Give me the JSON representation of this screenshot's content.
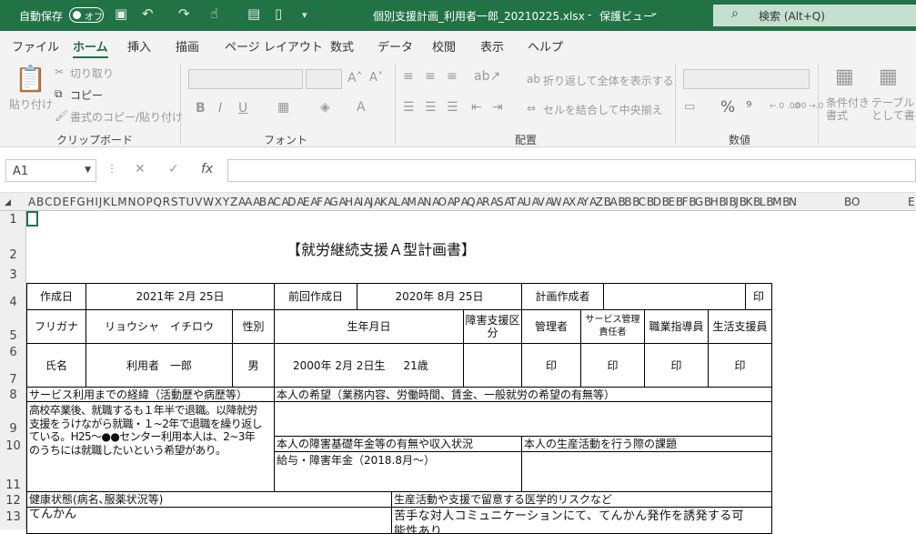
{
  "titlebar": {
    "autosave": "自動保存",
    "autosave_state": "オフ",
    "filename": "個別支援計画_利用者一郎_20210225.xlsx",
    "separator": "-",
    "view_mode": "保護ビュー",
    "mode_arrow": "⌄",
    "search_label": "検索 (Alt+Q)"
  },
  "tabs": [
    "ファイル",
    "ホーム",
    "挿入",
    "描画",
    "ページ レイアウト",
    "数式",
    "データ",
    "校閲",
    "表示",
    "ヘルプ"
  ],
  "ribbon": {
    "paste": "貼り付け",
    "cut": "切り取り",
    "copy": "コピー",
    "format_painter": "書式のコピー/貼り付け",
    "clipboard": "クリップボード",
    "font_group": "フォント",
    "bold": "B",
    "italic": "I",
    "underline": "U",
    "grow": "A˄",
    "shrink": "A˅",
    "wrap": "折り返して全体を表示する",
    "merge": "セルを結合して中央揃え",
    "align_group": "配置",
    "number_group": "数値",
    "percent": "%",
    "comma": "⁹",
    "dec_inc": "←.0 .00",
    "dec_dec": ".00 →.0",
    "cond_format": "条件付き書式",
    "table_format": "テーブルとして書式設定"
  },
  "formula": {
    "namebox": "A1",
    "cancel": "✕",
    "enter": "✓",
    "fx": "fx"
  },
  "columns": [
    "A",
    "B",
    "C",
    "D",
    "E",
    "F",
    "G",
    "H",
    "I",
    "J",
    "K",
    "L",
    "M",
    "N",
    "O",
    "P",
    "Q",
    "R",
    "S",
    "T",
    "U",
    "V",
    "W",
    "X",
    "Y",
    "Z",
    "A A",
    "AB",
    "AC",
    "AD",
    "AE",
    "AF",
    "AG",
    "AH",
    "AI",
    "AJ",
    "AK",
    "AL",
    "AM",
    "AN",
    "AO",
    "AP",
    "AQ",
    "AR",
    "AS",
    "AT",
    "AU",
    "AV",
    "AW",
    "AX",
    "AY",
    "AZ",
    "BA",
    "BB",
    "BC",
    "BD",
    "BE",
    "BF",
    "BG",
    "BH",
    "BI",
    "BJ",
    "BK",
    "BL",
    "BM",
    "BN",
    "BO",
    "BP"
  ],
  "columns_display": "A B C D E F G H I J K L M N O P Q R S T U V W X Y Z AA AB AC AD AE AF AG AH AI AJ AK AL AM AN AO AP AQ AR AS AT AU AV AW AX AY AZ BA BB BC BD BE BF BG BH BI BJ BK BL BM BN",
  "col_bo": "BO",
  "col_e": "E",
  "rows": [
    "1",
    "2",
    "3",
    "4",
    "5",
    "6",
    "7",
    "8",
    "9",
    "10",
    "11",
    "12",
    "13"
  ],
  "sheet": {
    "title": "【就労継続支援Ａ型計画書】",
    "created_label": "作成日",
    "created_date": "2021年 2月 25日",
    "prev_label": "前回作成日",
    "prev_date": "2020年 8月 25日",
    "planner_label": "計画作成者",
    "seal": "印",
    "furigana_label": "フリガナ",
    "furigana": "リョウシャ　イチロウ",
    "gender_label": "性別",
    "gender": "男",
    "dob_label": "生年月日",
    "dob": "2000年 2月 2日生",
    "age": "21歳",
    "disability_label": "障害支援区分",
    "manager": "管理者",
    "service_manager": "サービス管理責任者",
    "vocational": "職業指導員",
    "life_support": "生活支援員",
    "name_label": "氏名",
    "name": "利用者　一郎",
    "history_label": "サービス利用までの経緯（活動歴や病歴等）",
    "history_text": [
      "高校卒業後、就職するも１年半で退職。以降就労",
      "支援をうけながら就職・１~2年で退職を繰り返し",
      "ている。H25～●●センター利用本人は、2~3年",
      "のうちには就職したいという希望があり。"
    ],
    "wish_label": "本人の希望（業務内容、労働時間、賃金、一般就労の希望の有無等）",
    "pension_label": "本人の障害基礎年金等の有無や収入状況",
    "pension": "給与・障害年金（2018.8月～）",
    "issues_label": "本人の生産活動を行う際の課題",
    "health_label": "健康状態(病名､服薬状況等)",
    "health": "てんかん",
    "medical_label": "生産活動や支援で留意する医学的リスクなど",
    "medical": "苦手な対人コミュニケーションにて、てんかん発作を誘発する可",
    "medical_cont": "能性あり"
  }
}
